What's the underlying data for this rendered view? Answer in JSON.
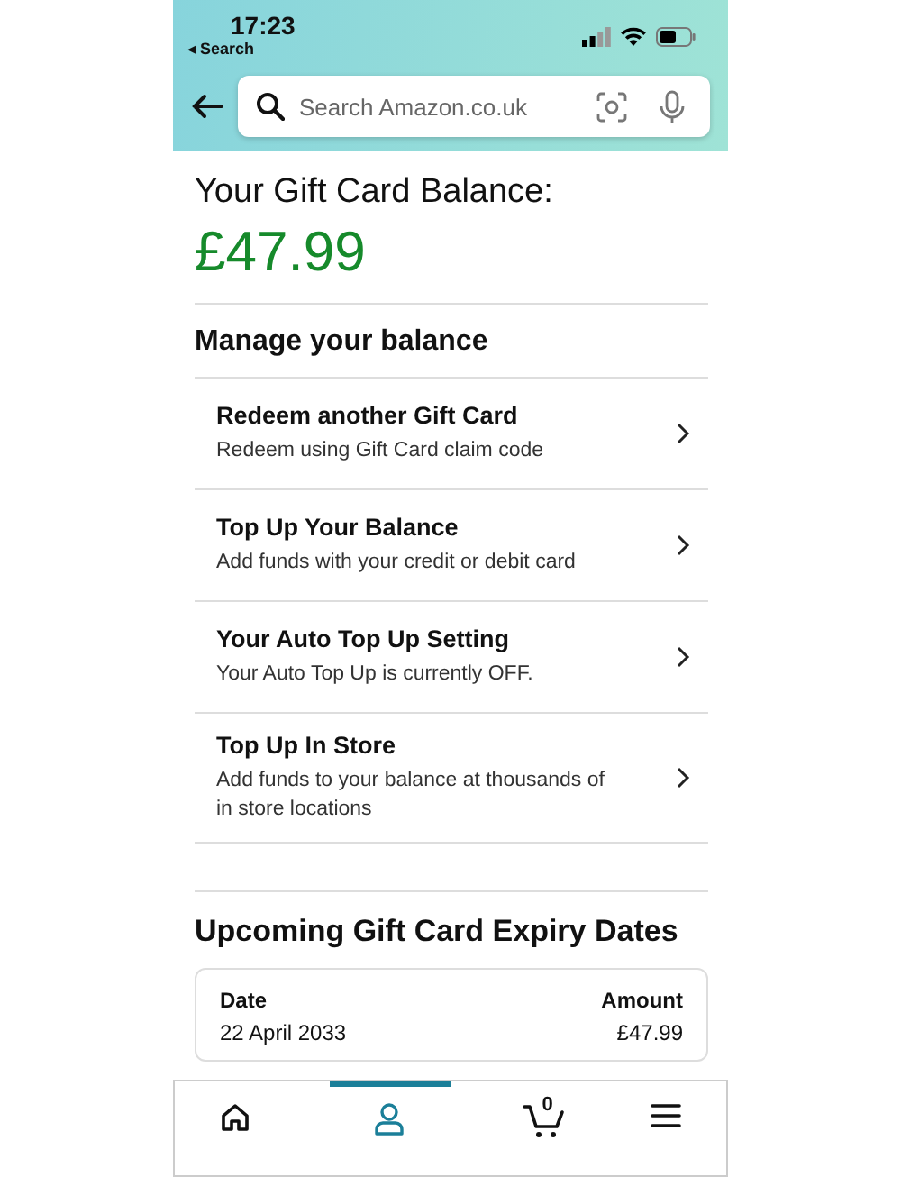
{
  "status_bar": {
    "time": "17:23",
    "back_label": "◂ Search"
  },
  "search": {
    "placeholder": "Search Amazon.co.uk"
  },
  "balance": {
    "label": "Your Gift Card Balance:",
    "amount": "£47.99"
  },
  "manage": {
    "title": "Manage your balance",
    "items": [
      {
        "title": "Redeem another Gift Card",
        "subtitle": "Redeem using Gift Card claim code"
      },
      {
        "title": "Top Up Your Balance",
        "subtitle": "Add funds with your credit or debit card"
      },
      {
        "title": "Your Auto Top Up Setting",
        "subtitle": "Your Auto Top Up is currently OFF."
      },
      {
        "title": "Top Up In Store",
        "subtitle": "Add funds to your balance at thousands of in store locations"
      }
    ]
  },
  "expiry": {
    "title": "Upcoming Gift Card Expiry Dates",
    "columns": [
      "Date",
      "Amount"
    ],
    "rows": [
      [
        "22 April 2033",
        "£47.99"
      ]
    ]
  },
  "bottom_nav": [
    {
      "kind": "home",
      "selected": false
    },
    {
      "kind": "account",
      "selected": true
    },
    {
      "kind": "cart",
      "selected": false,
      "count": "0"
    },
    {
      "kind": "menu",
      "selected": false
    }
  ]
}
